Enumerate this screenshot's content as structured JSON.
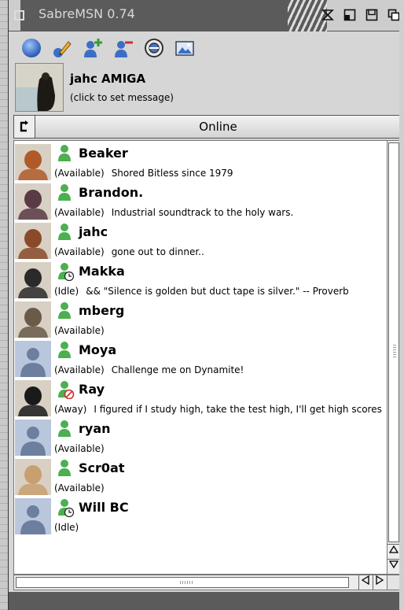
{
  "window": {
    "title": "SabreMSN 0.74"
  },
  "titlebar_gadgets": [
    "zoom-icon",
    "iconify-icon",
    "depth-icon",
    "clone-icon"
  ],
  "toolbar": {
    "buttons": [
      {
        "name": "status-orb-button",
        "icon": "blue-orb-icon"
      },
      {
        "name": "edit-profile-button",
        "icon": "pencil-icon"
      },
      {
        "name": "add-contact-button",
        "icon": "add-user-icon"
      },
      {
        "name": "remove-contact-button",
        "icon": "remove-user-icon"
      },
      {
        "name": "block-contact-button",
        "icon": "block-icon"
      },
      {
        "name": "picture-button",
        "icon": "picture-icon"
      }
    ]
  },
  "profile": {
    "name": "jahc AMIGA",
    "message": "(click to set message)"
  },
  "status": {
    "selected": "Online"
  },
  "contacts": [
    {
      "name": "Beaker",
      "status": "(Available)",
      "message": "Shored Bitless since 1979",
      "presence": "available",
      "avatar_color": "#b05a2a"
    },
    {
      "name": "Brandon.",
      "status": "(Available)",
      "message": "Industrial soundtrack to the holy wars.",
      "presence": "available",
      "avatar_color": "#5a3a44"
    },
    {
      "name": "jahc",
      "status": "(Available)",
      "message": "gone out to dinner..",
      "presence": "available",
      "avatar_color": "#8a4a2a"
    },
    {
      "name": "Makka",
      "status": "(Idle)",
      "message": "&& \"Silence is golden but duct tape is silver.\" -- Proverb",
      "presence": "idle",
      "avatar_color": "#2a2a2a"
    },
    {
      "name": "mberg",
      "status": "(Available)",
      "message": "",
      "presence": "available",
      "avatar_color": "#6a5a48"
    },
    {
      "name": "Moya",
      "status": "(Available)",
      "message": "Challenge me on Dynamite!",
      "presence": "available",
      "avatar_color": "placeholder"
    },
    {
      "name": "Ray",
      "status": "(Away)",
      "message": "I figured if I study high, take the test high, I'll get high scores",
      "presence": "away",
      "avatar_color": "#1a1a1a"
    },
    {
      "name": "ryan",
      "status": "(Available)",
      "message": "",
      "presence": "available",
      "avatar_color": "placeholder"
    },
    {
      "name": "Scr0at",
      "status": "(Available)",
      "message": "",
      "presence": "available",
      "avatar_color": "#c8a070"
    },
    {
      "name": "Will BC",
      "status": "(Idle)",
      "message": "",
      "presence": "idle",
      "avatar_color": "placeholder"
    }
  ],
  "colors": {
    "presence_green": "#4caf50",
    "titlebar_dark": "#5b5b5b",
    "window_bg": "#d6d6d6"
  }
}
